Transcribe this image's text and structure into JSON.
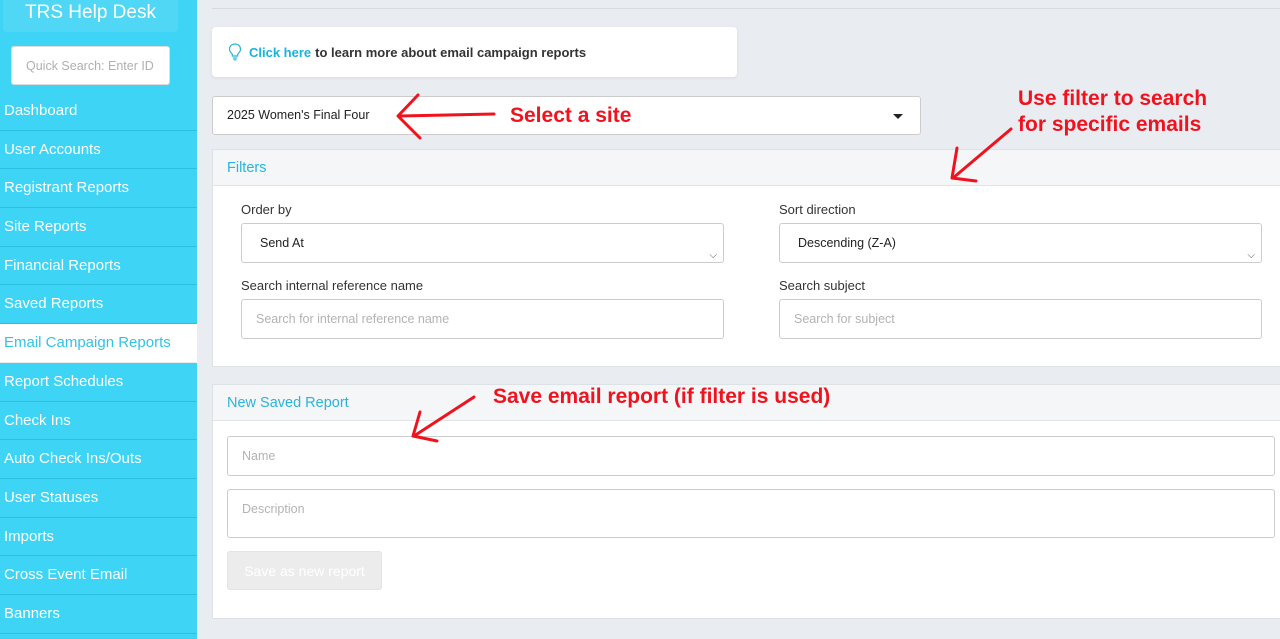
{
  "sidebar": {
    "brand": "TRS Help Desk",
    "search_placeholder": "Quick Search: Enter ID, f",
    "items": [
      {
        "label": "Dashboard"
      },
      {
        "label": "User Accounts"
      },
      {
        "label": "Registrant Reports"
      },
      {
        "label": "Site Reports"
      },
      {
        "label": "Financial Reports"
      },
      {
        "label": "Saved Reports"
      },
      {
        "label": "Email Campaign Reports"
      },
      {
        "label": "Report Schedules"
      },
      {
        "label": "Check Ins"
      },
      {
        "label": "Auto Check Ins/Outs"
      },
      {
        "label": "User Statuses"
      },
      {
        "label": "Imports"
      },
      {
        "label": "Cross Event Email"
      },
      {
        "label": "Banners"
      }
    ],
    "active_item": "Email Campaign Reports"
  },
  "info": {
    "link_text": "Click here",
    "text": "to learn more about email campaign reports"
  },
  "site_select": {
    "value": "2025 Women's Final Four"
  },
  "filters": {
    "title": "Filters",
    "order_by_label": "Order by",
    "order_by_value": "Send At",
    "sort_direction_label": "Sort direction",
    "sort_direction_value": "Descending (Z-A)",
    "internal_ref_label": "Search internal reference name",
    "internal_ref_placeholder": "Search for internal reference name",
    "subject_label": "Search subject",
    "subject_placeholder": "Search for subject"
  },
  "saved_report": {
    "title": "New Saved Report",
    "name_placeholder": "Name",
    "description_placeholder": "Description",
    "save_button": "Save as new report"
  },
  "annotations": {
    "select_site": "Select a site",
    "use_filter_line1": "Use filter to search",
    "use_filter_line2": "for specific emails",
    "save_report": "Save email report (if filter is used)"
  },
  "colors": {
    "sidebar": "#3dd4f5",
    "accent": "#29b5d9",
    "annotation": "#f0131e"
  }
}
